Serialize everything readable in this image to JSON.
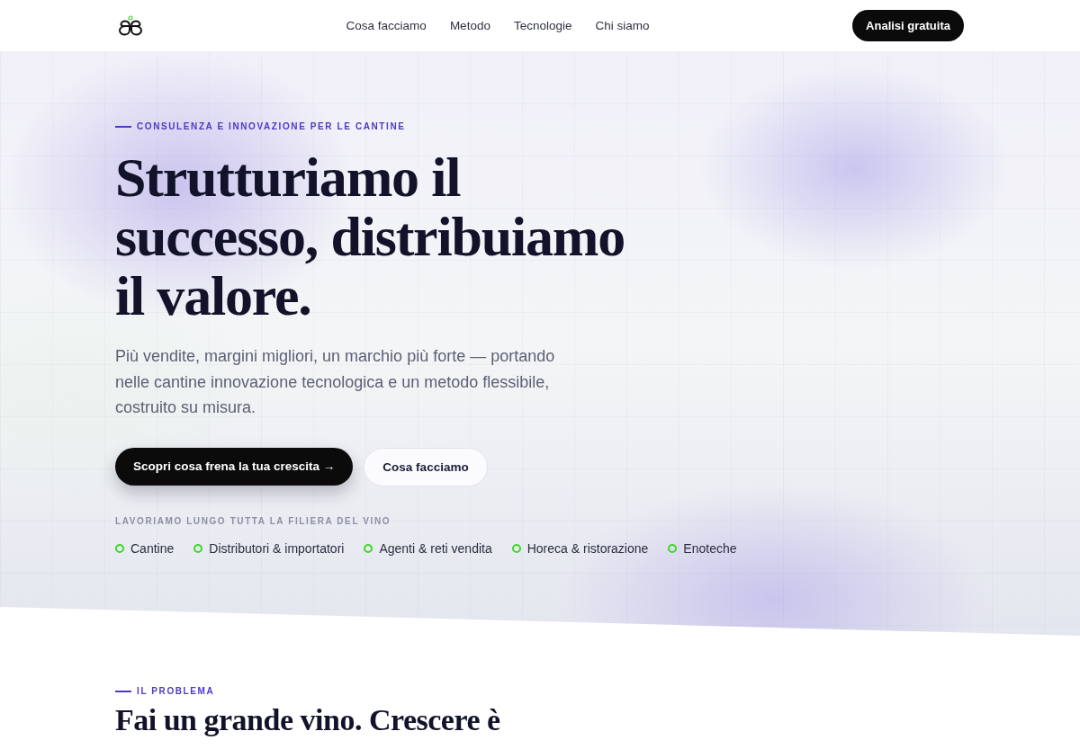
{
  "header": {
    "nav_links": [
      "Cosa facciamo",
      "Metodo",
      "Tecnologie",
      "Chi siamo"
    ],
    "cta": "Analisi gratuita"
  },
  "hero": {
    "eyebrow": "CONSULENZA E INNOVAZIONE PER LE CANTINE",
    "title": "Strutturiamo il successo, distribuiamo il valore.",
    "lead": "Più vendite, margini migliori, un marchio più forte — portando nelle cantine innovazione tecnologica e un metodo flessibile, costruito su misura.",
    "primary_button": "Scopri cosa frena la tua crescita →",
    "secondary_button": "Cosa facciamo",
    "audience_label": "LAVORIAMO LUNGO TUTTA LA FILIERA DEL VINO",
    "audiences": [
      "Cantine",
      "Distributori & importatori",
      "Agenti & reti vendita",
      "Horeca & ristorazione",
      "Enoteche"
    ]
  },
  "problem": {
    "eyebrow": "IL PROBLEMA",
    "title": "Fai un grande vino. Crescere è"
  }
}
